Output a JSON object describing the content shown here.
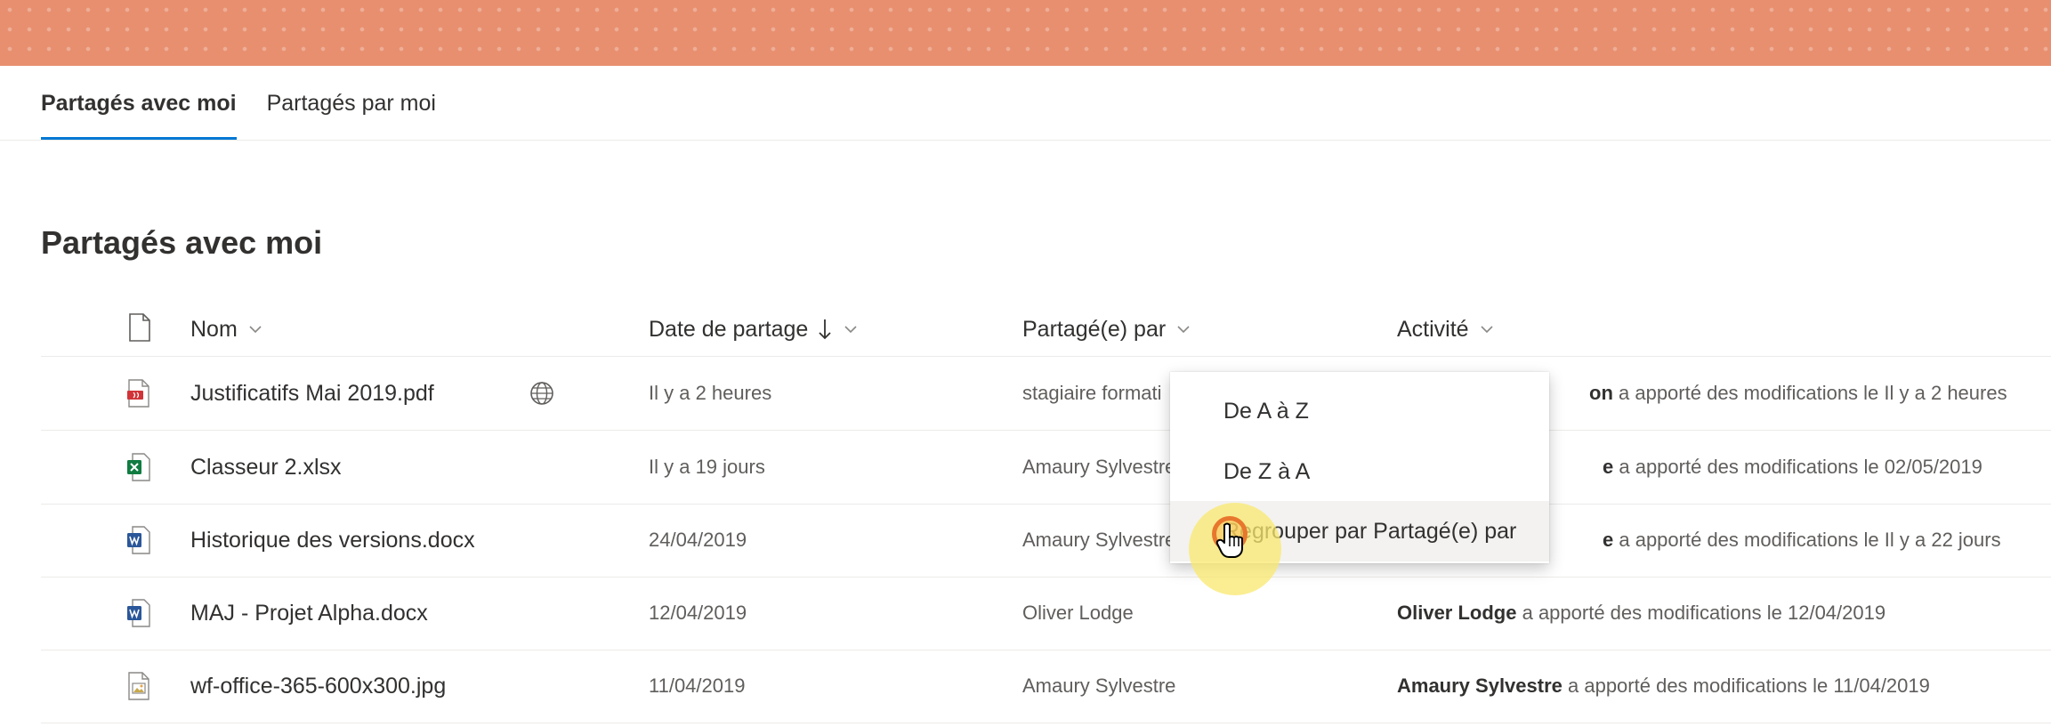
{
  "tabs": [
    {
      "label": "Partagés avec moi",
      "active": true
    },
    {
      "label": "Partagés par moi",
      "active": false
    }
  ],
  "page_title": "Partagés avec moi",
  "columns": {
    "name": "Nom",
    "date": "Date de partage",
    "shared_by": "Partagé(e) par",
    "activity": "Activité"
  },
  "rows": [
    {
      "icon": "pdf-file-icon",
      "name": "Justificatifs Mai 2019.pdf",
      "shared_icon": "globe-icon",
      "date": "Il y a 2 heures",
      "shared_by": "stagiaire formati",
      "activity_name": "on",
      "activity_text": " a apporté des modifications le Il y a 2 heures"
    },
    {
      "icon": "excel-file-icon",
      "name": "Classeur 2.xlsx",
      "date": "Il y a 19 jours",
      "shared_by": "Amaury Sylvestre",
      "activity_name": "e",
      "activity_text": " a apporté des modifications le 02/05/2019"
    },
    {
      "icon": "word-file-icon",
      "name": "Historique des versions.docx",
      "date": "24/04/2019",
      "shared_by": "Amaury Sylvestre",
      "activity_name": "e",
      "activity_text": " a apporté des modifications le Il y a 22 jours"
    },
    {
      "icon": "word-file-icon",
      "name": "MAJ - Projet Alpha.docx",
      "date": "12/04/2019",
      "shared_by": "Oliver Lodge",
      "activity_name": "Oliver Lodge",
      "activity_text": " a apporté des modifications le 12/04/2019"
    },
    {
      "icon": "image-file-icon",
      "name": "wf-office-365-600x300.jpg",
      "date": "11/04/2019",
      "shared_by": "Amaury Sylvestre",
      "activity_name": "Amaury Sylvestre",
      "activity_text": " a apporté des modifications le 11/04/2019"
    }
  ],
  "menu": {
    "items": [
      {
        "label": "De A à Z"
      },
      {
        "label": "De Z à A"
      },
      {
        "label": "Regrouper par Partagé(e) par",
        "hovered": true
      }
    ]
  },
  "colors": {
    "banner": "#e88f6f",
    "accent": "#0078d4",
    "pdf": "#d13438",
    "excel": "#107c41",
    "word": "#2b579a",
    "highlight": "#fae86e"
  }
}
